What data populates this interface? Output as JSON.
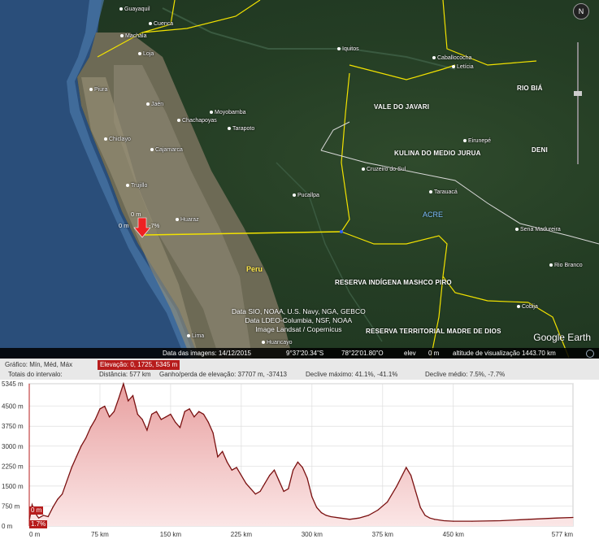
{
  "map": {
    "places": [
      {
        "name": "Guayaquil",
        "id": "guayaquil"
      },
      {
        "name": "Cuenca",
        "id": "cuenca"
      },
      {
        "name": "Machala",
        "id": "machala"
      },
      {
        "name": "Loja",
        "id": "loja"
      },
      {
        "name": "Iquitos",
        "id": "iquitos"
      },
      {
        "name": "Caballococha",
        "id": "caballococha"
      },
      {
        "name": "Letícia",
        "id": "leticia"
      },
      {
        "name": "Piura",
        "id": "piura"
      },
      {
        "name": "Jaén",
        "id": "jaen"
      },
      {
        "name": "Moyobamba",
        "id": "moyobamba"
      },
      {
        "name": "Chachapoyas",
        "id": "chachapoyas"
      },
      {
        "name": "Tarapoto",
        "id": "tarapoto"
      },
      {
        "name": "Chiclayo",
        "id": "chiclayo"
      },
      {
        "name": "Cajamarca",
        "id": "cajamarca"
      },
      {
        "name": "Trujillo",
        "id": "trujillo"
      },
      {
        "name": "Eirunepé",
        "id": "eirunepe"
      },
      {
        "name": "Cruzeiro do Sul",
        "id": "cruzeiro"
      },
      {
        "name": "Tarauacá",
        "id": "tarauaca"
      },
      {
        "name": "Pucallpa",
        "id": "pucallpa"
      },
      {
        "name": "Huaraz",
        "id": "huaraz"
      },
      {
        "name": "Sena Madureira",
        "id": "sena"
      },
      {
        "name": "Rio Branco",
        "id": "riobranco"
      },
      {
        "name": "Cobija",
        "id": "cobija"
      },
      {
        "name": "Lima",
        "id": "lima"
      },
      {
        "name": "Huancayo",
        "id": "huancayo"
      }
    ],
    "regions": {
      "vale": "VALE DO JAVARI",
      "kulina": "KULINA DO MEDIO JURUA",
      "riobia": "RIO BIÁ",
      "deni": "DENI",
      "mashco": "RESERVA INDÍGENA MASHCO PIRO",
      "madre": "RESERVA TERRITORIAL MADRE DE DIOS"
    },
    "acre": "ACRE",
    "peru": "Peru",
    "marker_top": "0 m",
    "marker_left": "0 m",
    "marker_pct": "-7%",
    "credits": [
      "Data SIO, NOAA, U.S. Navy, NGA, GEBCO",
      "Data LDEO-Columbia, NSF, NOAA",
      "Image Landsat / Copernicus"
    ],
    "brand": "Google Earth",
    "compass": "N"
  },
  "status": {
    "imagery_date": "Data das imagens: 14/12/2015",
    "lat": "9°37'20.34\"S",
    "lon": "78°22'01.80\"O",
    "elev_label": "elev",
    "elev_value": "0 m",
    "eye_alt": "altitude de visualização 1443.70 km"
  },
  "profile": {
    "graph_label": "Gráfico: Mín, Méd, Máx",
    "elevation_sel": "Elevação: 0, 1725, 5345 m",
    "totals_label": "Totais do intervalo:",
    "distance": "Distância: 577 km",
    "gain_loss": "Ganho/perda de elevação: 37707 m, -37413",
    "slope_max": "Declive máximo: 41.1%, -41.1%",
    "slope_avg": "Declive médio: 7.5%, -7.7%",
    "cursor_top": "0 m",
    "cursor_bottom": "1.7%",
    "cursor_axis": "0 m"
  },
  "chart_data": {
    "type": "area",
    "xlabel": "",
    "ylabel": "",
    "x_ticks": [
      "0 m",
      "75 km",
      "150 km",
      "225 km",
      "300 km",
      "375 km",
      "450 km",
      "577 km"
    ],
    "y_ticks": [
      "5345 m",
      "4500 m",
      "3750 m",
      "3000 m",
      "2250 m",
      "1500 m",
      "750 m",
      "0 m"
    ],
    "xlim": [
      0,
      577
    ],
    "ylim": [
      0,
      5345
    ],
    "series": [
      {
        "x": [
          0,
          3,
          6,
          10,
          15,
          20,
          25,
          30,
          35,
          40,
          45,
          50,
          55,
          60,
          65,
          70,
          75,
          80,
          85,
          90,
          95,
          100,
          105,
          110,
          115,
          120,
          125,
          130,
          135,
          140,
          145,
          150,
          155,
          160,
          165,
          170,
          175,
          180,
          185,
          190,
          195,
          200,
          205,
          210,
          215,
          220,
          225,
          230,
          235,
          240,
          245,
          250,
          255,
          260,
          265,
          270,
          275,
          280,
          285,
          290,
          295,
          300,
          305,
          310,
          315,
          320,
          330,
          340,
          350,
          360,
          370,
          380,
          390,
          400,
          405,
          410,
          415,
          420,
          425,
          430,
          440,
          450,
          470,
          500,
          530,
          560,
          577
        ],
        "y": [
          200,
          800,
          500,
          300,
          400,
          350,
          700,
          1000,
          1200,
          1700,
          2200,
          2600,
          3000,
          3300,
          3700,
          4000,
          4400,
          4500,
          4100,
          4300,
          4800,
          5345,
          4700,
          4900,
          4200,
          4000,
          3600,
          4200,
          4300,
          4000,
          4100,
          4200,
          3900,
          3700,
          4300,
          4400,
          4100,
          4300,
          4200,
          3900,
          3500,
          2600,
          2800,
          2400,
          2100,
          2200,
          1900,
          1600,
          1400,
          1200,
          1300,
          1600,
          1900,
          2100,
          1700,
          1300,
          1400,
          2100,
          2400,
          2200,
          1800,
          1100,
          700,
          500,
          400,
          350,
          300,
          250,
          300,
          400,
          600,
          900,
          1500,
          2200,
          1900,
          1300,
          700,
          400,
          300,
          250,
          200,
          180,
          180,
          200,
          250,
          300,
          320
        ]
      }
    ]
  }
}
